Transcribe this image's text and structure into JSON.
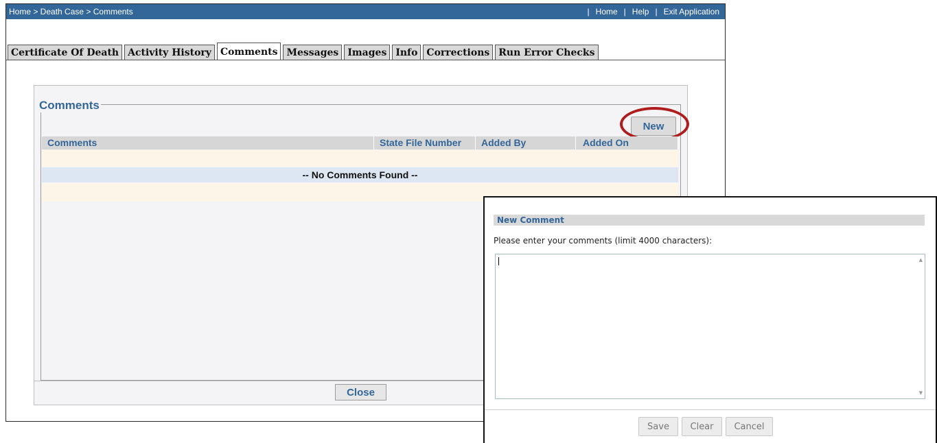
{
  "topbar": {
    "breadcrumb": "Home > Death Case > Comments",
    "links": [
      "Home",
      "Help",
      "Exit Application"
    ]
  },
  "tabs": [
    {
      "label": "Certificate Of Death",
      "active": false
    },
    {
      "label": "Activity History",
      "active": false
    },
    {
      "label": "Comments",
      "active": true
    },
    {
      "label": "Messages",
      "active": false
    },
    {
      "label": "Images",
      "active": false
    },
    {
      "label": "Info",
      "active": false
    },
    {
      "label": "Corrections",
      "active": false
    },
    {
      "label": "Run Error Checks",
      "active": false
    }
  ],
  "comments_panel": {
    "legend": "Comments",
    "new_label": "New",
    "columns": [
      "Comments",
      "State File Number",
      "Added By",
      "Added On"
    ],
    "empty_message": "-- No Comments Found --",
    "close_label": "Close"
  },
  "dialog": {
    "title": "New Comment",
    "instruction": "Please enter your comments (limit 4000 characters):",
    "textarea_value": "",
    "buttons": {
      "save": "Save",
      "clear": "Clear",
      "cancel": "Cancel"
    }
  },
  "colors": {
    "topbar_bg": "#336699",
    "accent_text": "#336699",
    "highlight": "#b01c1c",
    "row_tan": "#fdf6e8",
    "row_blue": "#dde7f3"
  }
}
